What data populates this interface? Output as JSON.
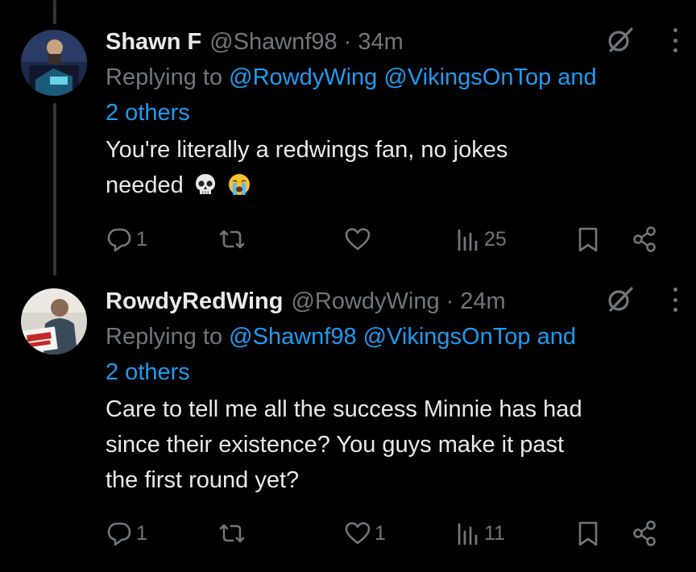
{
  "tweets": [
    {
      "name": "Shawn F",
      "handle": "@Shawnf98",
      "dot": "·",
      "time": "34m",
      "replying_prefix": "Replying to",
      "mention1": "@RowdyWing",
      "mention2": "@VikingsOnTop",
      "and_word": "and",
      "others": "2 others",
      "text_line1": "You're literally a redwings fan, no jokes",
      "text_line2": "needed",
      "emojis": [
        "skull-emoji",
        "loudly-crying-face-emoji"
      ],
      "replies": "1",
      "retweets": "",
      "likes": "",
      "views": "25"
    },
    {
      "name": "RowdyRedWing",
      "handle": "@RowdyWing",
      "dot": "·",
      "time": "24m",
      "replying_prefix": "Replying to",
      "mention1": "@Shawnf98",
      "mention2": "@VikingsOnTop",
      "and_word": "and",
      "others": "2 others",
      "text_line1": "Care to tell me all the success Minnie has had",
      "text_line2": "since their existence? You guys make it past",
      "text_line3": "the first round yet?",
      "replies": "1",
      "retweets": "",
      "likes": "1",
      "views": "11"
    }
  ],
  "colors": {
    "background": "#000000",
    "text": "#e7e9ea",
    "muted": "#71767b",
    "link": "#1d9bf0",
    "thread_line": "#333639"
  },
  "icons": [
    "reply-icon",
    "retweet-icon",
    "like-icon",
    "views-icon",
    "bookmark-icon",
    "share-icon",
    "grok-icon",
    "more-icon"
  ]
}
